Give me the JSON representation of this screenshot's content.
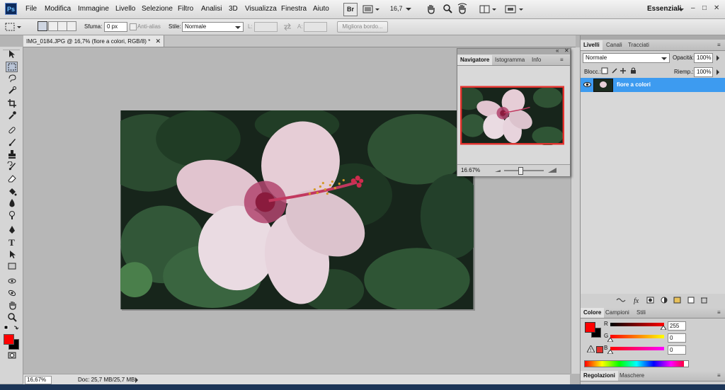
{
  "menu": {
    "logo": "Ps",
    "items": [
      "File",
      "Modifica",
      "Immagine",
      "Livello",
      "Selezione",
      "Filtro",
      "Analisi",
      "3D",
      "Visualizza",
      "Finestra",
      "Aiuto"
    ],
    "bridge_label": "Br",
    "zoom_value": "16,7",
    "workspace": "Essenziali"
  },
  "options": {
    "feather_label": "Sfuma:",
    "feather_value": "0 px",
    "antialias_label": "Anti-alias",
    "style_label": "Stile:",
    "style_value": "Normale",
    "width_label": "L:",
    "height_label": "A:",
    "refine_edge_label": "Migliora bordo..."
  },
  "document": {
    "tab_title": "IMG_0184.JPG @ 16,7% (fiore a colori, RGB/8) *",
    "zoom": "16,67%",
    "doc_info": "Doc: 25,7 MB/25,7 MB"
  },
  "navigator": {
    "tabs": [
      "Navigatore",
      "Istogramma",
      "Info"
    ],
    "zoom": "16.67%"
  },
  "layers": {
    "tabs": [
      "Livelli",
      "Canali",
      "Tracciati"
    ],
    "blend_mode": "Normale",
    "opacity_label": "Opacità:",
    "opacity_value": "100%",
    "lock_label": "Blocc.:",
    "fill_label": "Riemp.:",
    "fill_value": "100%",
    "layer_name": "fiore a colori"
  },
  "color_panel": {
    "tabs": [
      "Colore",
      "Campioni",
      "Stili"
    ],
    "r_label": "R",
    "g_label": "G",
    "b_label": "B",
    "r_value": "255",
    "g_value": "0",
    "b_value": "0",
    "foreground_color": "#ff0000",
    "background_color": "#000000"
  },
  "adjust_tabs": [
    "Regolazioni",
    "Maschere"
  ],
  "colors": {
    "selection_blue": "#3d9bf0",
    "navigator_frame": "#e8322e"
  }
}
